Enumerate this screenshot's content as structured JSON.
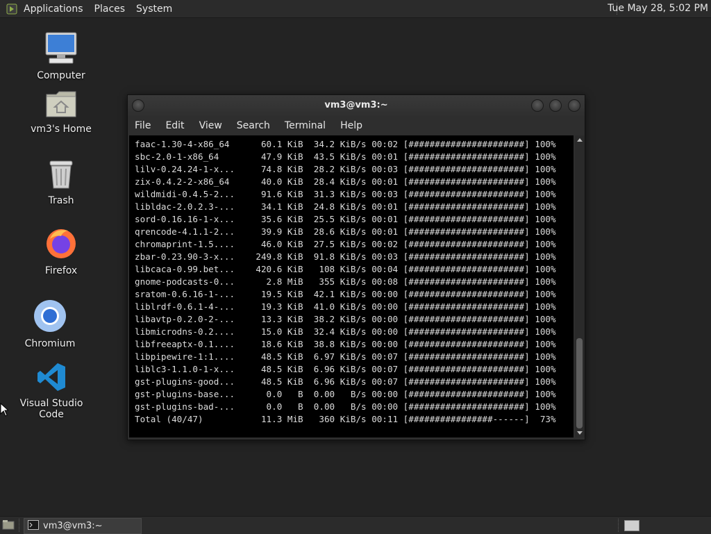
{
  "top_panel": {
    "menus": [
      "Applications",
      "Places",
      "System"
    ],
    "clock": "Tue May 28,  5:02 PM"
  },
  "desktop_icons": [
    {
      "label": "Computer",
      "icon": "computer-icon"
    },
    {
      "label": "vm3's Home",
      "icon": "home-folder-icon"
    },
    {
      "label": "Trash",
      "icon": "trash-icon"
    },
    {
      "label": "Firefox",
      "icon": "firefox-icon"
    },
    {
      "label": "Chromium",
      "icon": "chromium-icon"
    },
    {
      "label": "Visual Studio Code",
      "icon": "vscode-icon"
    }
  ],
  "terminal": {
    "title": "vm3@vm3:~",
    "menu": [
      "File",
      "Edit",
      "View",
      "Search",
      "Terminal",
      "Help"
    ],
    "lines": [
      "faac-1.30-4-x86_64      60.1 KiB  34.2 KiB/s 00:02 [######################] 100%",
      "sbc-2.0-1-x86_64        47.9 KiB  43.5 KiB/s 00:01 [######################] 100%",
      "lilv-0.24.24-1-x...     74.8 KiB  28.2 KiB/s 00:03 [######################] 100%",
      "zix-0.4.2-2-x86_64      40.0 KiB  28.4 KiB/s 00:01 [######################] 100%",
      "wildmidi-0.4.5-2...     91.6 KiB  31.3 KiB/s 00:03 [######################] 100%",
      "libldac-2.0.2.3-...     34.1 KiB  24.8 KiB/s 00:01 [######################] 100%",
      "sord-0.16.16-1-x...     35.6 KiB  25.5 KiB/s 00:01 [######################] 100%",
      "qrencode-4.1.1-2...     39.9 KiB  28.6 KiB/s 00:01 [######################] 100%",
      "chromaprint-1.5....     46.0 KiB  27.5 KiB/s 00:02 [######################] 100%",
      "zbar-0.23.90-3-x...    249.8 KiB  91.8 KiB/s 00:03 [######################] 100%",
      "libcaca-0.99.bet...    420.6 KiB   108 KiB/s 00:04 [######################] 100%",
      "gnome-podcasts-0...      2.8 MiB   355 KiB/s 00:08 [######################] 100%",
      "sratom-0.6.16-1-...     19.5 KiB  42.1 KiB/s 00:00 [######################] 100%",
      "liblrdf-0.6.1-4-...     19.3 KiB  41.0 KiB/s 00:00 [######################] 100%",
      "libavtp-0.2.0-2-...     13.3 KiB  38.2 KiB/s 00:00 [######################] 100%",
      "libmicrodns-0.2....     15.0 KiB  32.4 KiB/s 00:00 [######################] 100%",
      "libfreeaptx-0.1....     18.6 KiB  38.8 KiB/s 00:00 [######################] 100%",
      "libpipewire-1:1....     48.5 KiB  6.97 KiB/s 00:07 [######################] 100%",
      "liblc3-1.1.0-1-x...     48.5 KiB  6.96 KiB/s 00:07 [######################] 100%",
      "gst-plugins-good...     48.5 KiB  6.96 KiB/s 00:07 [######################] 100%",
      "gst-plugins-base...      0.0   B  0.00   B/s 00:00 [######################] 100%",
      "gst-plugins-bad-...      0.0   B  0.00   B/s 00:00 [######################] 100%",
      "Total (40/47)           11.3 MiB   360 KiB/s 00:11 [################------]  73%"
    ]
  },
  "taskbar": {
    "window_button": "vm3@vm3:~"
  }
}
